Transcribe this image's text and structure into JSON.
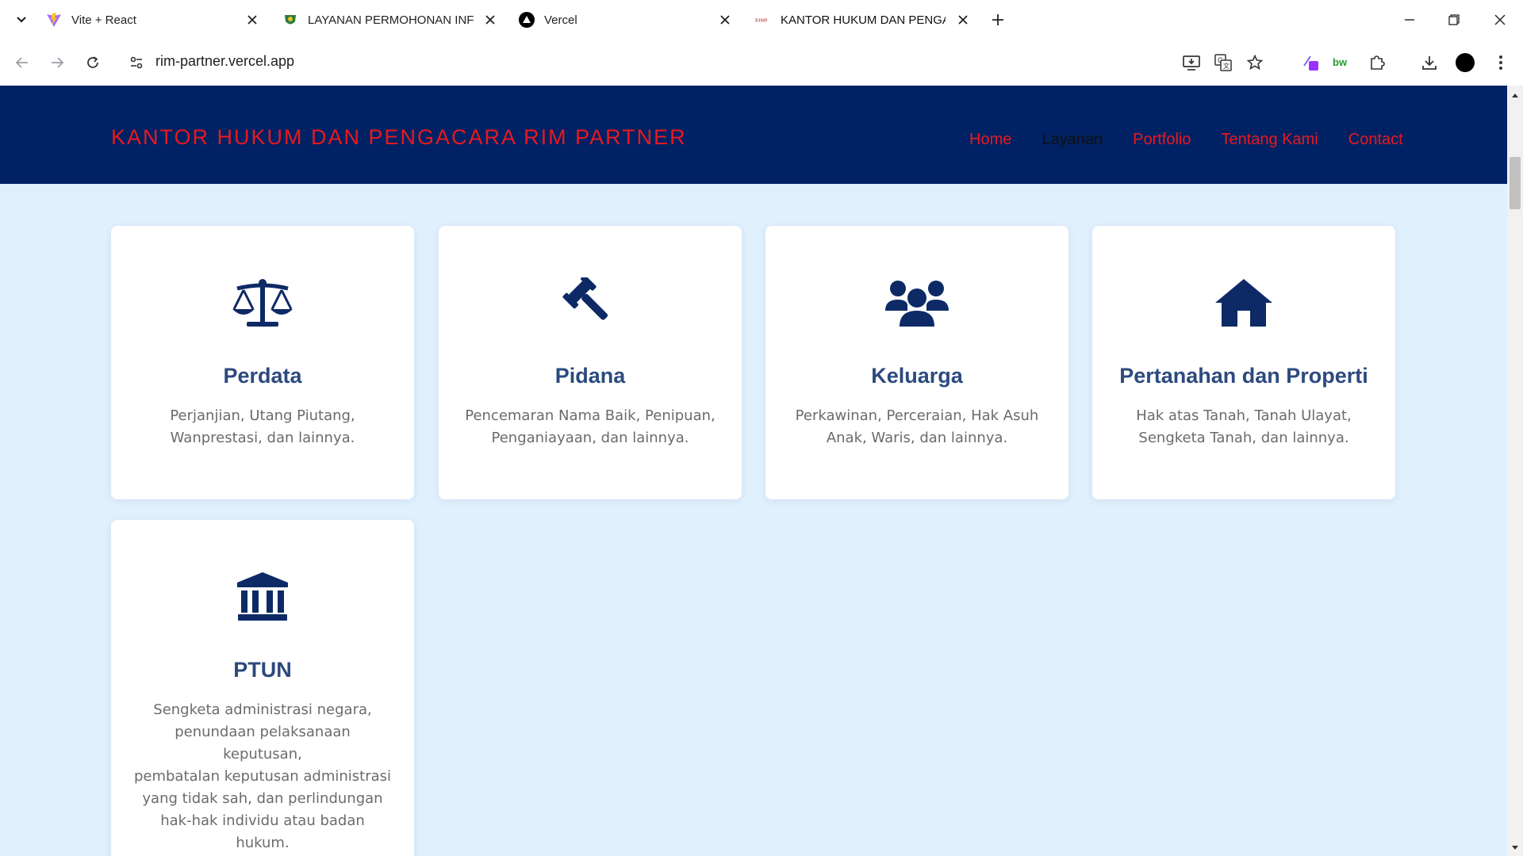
{
  "browser": {
    "tabs": [
      {
        "title": "Vite + React",
        "favicon": "vite-icon",
        "active": false
      },
      {
        "title": "LAYANAN PERMOHONAN INFO",
        "favicon": "government-emblem-icon",
        "active": false
      },
      {
        "title": "Vercel",
        "favicon": "vercel-icon",
        "active": false
      },
      {
        "title": "KANTOR HUKUM DAN PENGAC",
        "favicon": "rimp-icon",
        "favicon_text": "RIMP",
        "active": true
      }
    ],
    "url": "rim-partner.vercel.app"
  },
  "site": {
    "brand": "KANTOR HUKUM DAN PENGACARA RIM PARTNER",
    "nav": [
      {
        "label": "Home",
        "current": false
      },
      {
        "label": "Layanan",
        "current": true
      },
      {
        "label": "Portfolio",
        "current": false
      },
      {
        "label": "Tentang Kami",
        "current": false
      },
      {
        "label": "Contact",
        "current": false
      }
    ]
  },
  "services": [
    {
      "title": "Perdata",
      "icon": "scale-balance-icon",
      "lines": [
        "Perjanjian, Utang Piutang,",
        "Wanprestasi, dan lainnya."
      ]
    },
    {
      "title": "Pidana",
      "icon": "gavel-icon",
      "lines": [
        "Pencemaran Nama Baik, Penipuan,",
        "Penganiayaan, dan lainnya."
      ]
    },
    {
      "title": "Keluarga",
      "icon": "users-icon",
      "lines": [
        "Perkawinan, Perceraian, Hak Asuh",
        "Anak, Waris, dan lainnya."
      ]
    },
    {
      "title": "Pertanahan dan Properti",
      "icon": "house-icon",
      "lines": [
        "Hak atas Tanah, Tanah Ulayat,",
        "Sengketa Tanah, dan lainnya."
      ]
    },
    {
      "title": "PTUN",
      "icon": "landmark-icon",
      "lines": [
        "Sengketa administrasi negara,",
        "penundaan pelaksanaan keputusan,",
        "pembatalan keputusan administrasi",
        "yang tidak sah, dan perlindungan",
        "hak-hak individu atau badan hukum."
      ]
    }
  ],
  "colors": {
    "header_bg": "#002163",
    "accent_red": "#e8191f",
    "page_bg": "#e1f0fd",
    "icon_navy": "#0d2a66",
    "title_blue": "#2c4a7e"
  }
}
